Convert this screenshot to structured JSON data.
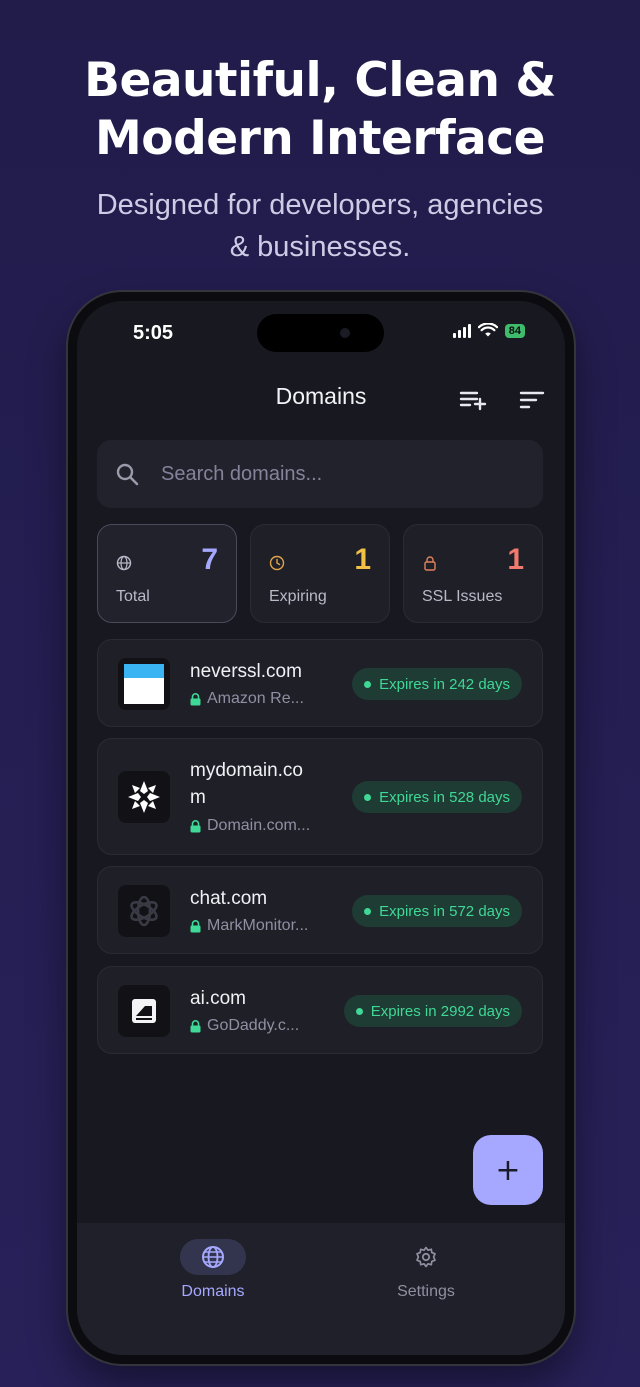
{
  "hero": {
    "title_line1": "Beautiful, Clean &",
    "title_line2": "Modern Interface",
    "subtitle_line1": "Designed for developers, agencies",
    "subtitle_line2": "& businesses."
  },
  "status_bar": {
    "time": "5:05",
    "battery": "84"
  },
  "header": {
    "title": "Domains",
    "icons": [
      "add-list-icon",
      "sort-icon"
    ]
  },
  "search": {
    "placeholder": "Search domains..."
  },
  "stats": [
    {
      "label": "Total",
      "value": "7",
      "icon": "globe-icon",
      "color": "#a6a8ff"
    },
    {
      "label": "Expiring",
      "value": "1",
      "icon": "clock-icon",
      "color": "#f2c046"
    },
    {
      "label": "SSL Issues",
      "value": "1",
      "icon": "lock-icon",
      "color": "#f07a6e"
    }
  ],
  "domains": [
    {
      "name": "neverssl.com",
      "registrar": "Amazon Re...",
      "status": "Expires in 242 days"
    },
    {
      "name_line1": "mydomain.co",
      "name_line2": "m",
      "registrar": "Domain.com...",
      "status": "Expires in 528 days"
    },
    {
      "name": "chat.com",
      "registrar": "MarkMonitor...",
      "status": "Expires in 572 days"
    },
    {
      "name": "ai.com",
      "registrar": "GoDaddy.c...",
      "status": "Expires in 2992 days"
    }
  ],
  "fab": {
    "label": "+"
  },
  "tabs": [
    {
      "label": "Domains",
      "icon": "globe-icon",
      "active": true
    },
    {
      "label": "Settings",
      "icon": "gear-icon",
      "active": false
    }
  ],
  "colors": {
    "accent": "#a6a8ff",
    "success": "#3fd896",
    "warning": "#f2c046",
    "danger": "#f07a6e"
  }
}
